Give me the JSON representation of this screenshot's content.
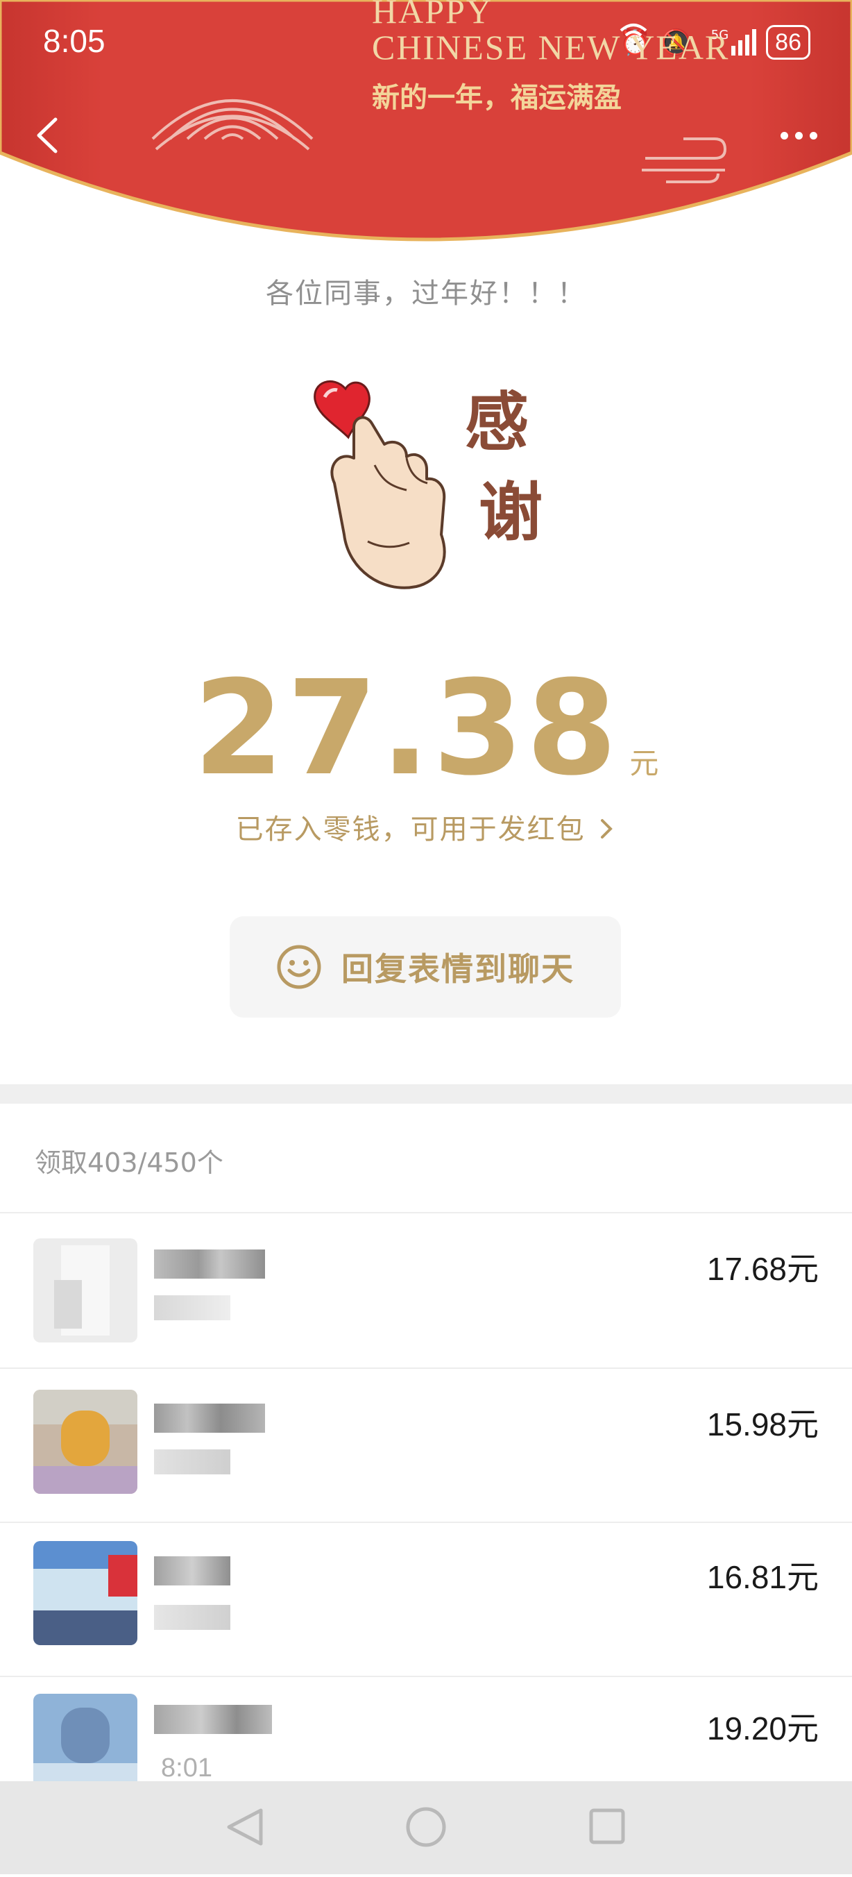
{
  "status_bar": {
    "time": "8:05",
    "battery": "86",
    "network": "5G"
  },
  "header": {
    "banner_line1": "HAPPY",
    "banner_line2": "CHINESE NEW YEAR",
    "slogan": "新的一年，福运满盈",
    "colors": {
      "red": "#d9413a",
      "gold_border": "#e8b35c"
    }
  },
  "greeting": "各位同事，过年好！！！",
  "sticker": {
    "text1": "感",
    "text2": "谢",
    "icon": "heart-finger-sticker"
  },
  "amount": {
    "value": "27.38",
    "unit": "元",
    "color": "#c8a86a"
  },
  "saved_note": "已存入零钱，可用于发红包",
  "reply_button": {
    "label": "回复表情到聊天",
    "icon": "smiley-icon"
  },
  "received": {
    "label": "领取403/450个"
  },
  "recipients": [
    {
      "amount": "17.68元"
    },
    {
      "amount": "15.98元"
    },
    {
      "amount": "16.81元"
    },
    {
      "amount": "19.20元",
      "time": "8:01"
    }
  ]
}
